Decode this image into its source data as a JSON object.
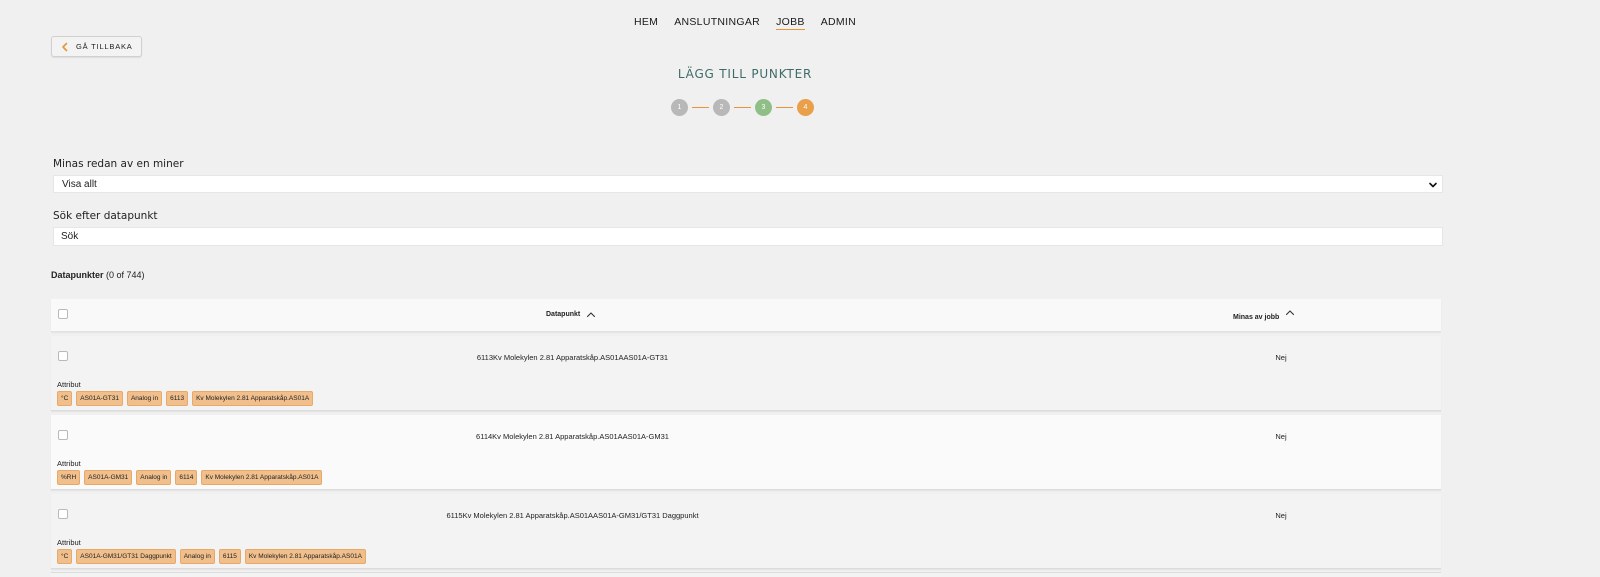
{
  "nav": {
    "items": [
      {
        "label": "HEM",
        "active": false
      },
      {
        "label": "ANSLUTNINGAR",
        "active": false
      },
      {
        "label": "JOBB",
        "active": true
      },
      {
        "label": "ADMIN",
        "active": false
      }
    ]
  },
  "back_button": {
    "label": "GÅ TILLBAKA"
  },
  "page_title": "LÄGG TILL PUNKTER",
  "stepper": {
    "steps": [
      "1",
      "2",
      "3",
      "4"
    ],
    "current_step": 4
  },
  "filter": {
    "label": "Minas redan av en miner",
    "selected": "Visa allt"
  },
  "search": {
    "label": "Sök efter datapunkt",
    "placeholder": "Sök"
  },
  "datapoints": {
    "title": "Datapunkter",
    "count_text": "(0 of 744)"
  },
  "table": {
    "col_datapunkt": "Datapunkt",
    "col_minas": "Minas av jobb",
    "rows": [
      {
        "name": "6113Kv Molekylen 2.81 Apparatskåp.AS01AAS01A-GT31",
        "minas": "Nej",
        "attr_label": "Attribut",
        "tags": [
          "°C",
          "AS01A-GT31",
          "Analog in",
          "6113",
          "Kv Molekylen 2.81 Apparatskåp.AS01A"
        ]
      },
      {
        "name": "6114Kv Molekylen 2.81 Apparatskåp.AS01AAS01A-GM31",
        "minas": "Nej",
        "attr_label": "Attribut",
        "tags": [
          "%RH",
          "AS01A-GM31",
          "Analog in",
          "6114",
          "Kv Molekylen 2.81 Apparatskåp.AS01A"
        ]
      },
      {
        "name": "6115Kv Molekylen 2.81 Apparatskåp.AS01AAS01A-GM31/GT31 Daggpunkt",
        "minas": "Nej",
        "attr_label": "Attribut",
        "tags": [
          "°C",
          "AS01A-GM31/GT31 Daggpunkt",
          "Analog in",
          "6115",
          "Kv Molekylen 2.81 Apparatskåp.AS01A"
        ]
      }
    ]
  },
  "colors": {
    "accent": "#e8943a",
    "title_teal": "#3e6b68",
    "step_done": "#b8b8b8",
    "step_previous": "#8fbf86",
    "step_current": "#e8a04a",
    "tag_bg": "#f0bf8c"
  },
  "icons": {
    "back": "chevron-left-icon",
    "select": "chevron-down-icon",
    "sort": "caret-up-icon"
  }
}
